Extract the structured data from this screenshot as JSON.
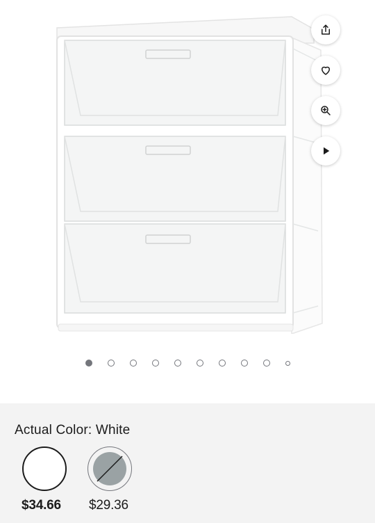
{
  "product": {
    "image_alt": "White 3-drawer plastic storage tower with clear drawers",
    "actions": [
      {
        "name": "share-icon",
        "icon": "share"
      },
      {
        "name": "heart-icon",
        "icon": "heart"
      },
      {
        "name": "zoom-icon",
        "icon": "zoom-in"
      },
      {
        "name": "play-icon",
        "icon": "play"
      }
    ],
    "carousel": {
      "total": 10,
      "active_index": 0
    }
  },
  "variants": {
    "label": "Actual Color: White",
    "options": [
      {
        "color": "#ffffff",
        "price": "$34.66",
        "selected": true,
        "available": true
      },
      {
        "color": "#9aa2a4",
        "price": "$29.36",
        "selected": false,
        "available": false
      }
    ]
  },
  "colors": {
    "accent": "#1b1b1b",
    "panel_bg": "#f3f3f3",
    "dot": "#74767c"
  }
}
